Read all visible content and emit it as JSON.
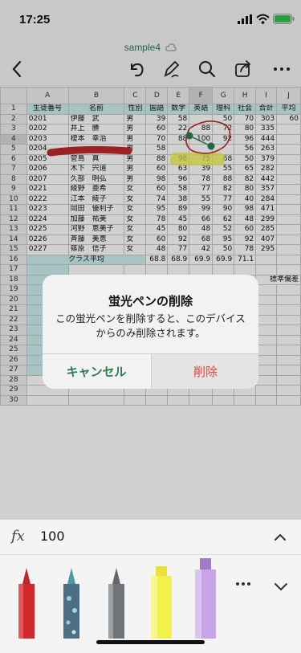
{
  "status": {
    "time": "17:25"
  },
  "document": {
    "title": "sample4"
  },
  "sheet": {
    "columns": [
      "",
      "A",
      "B",
      "C",
      "D",
      "E",
      "F",
      "G",
      "H",
      "I",
      "J"
    ],
    "header_row": [
      "生徒番号",
      "名前",
      "性別",
      "国語",
      "数学",
      "英語",
      "理科",
      "社会",
      "合計",
      "平均"
    ],
    "rows": [
      [
        "0201",
        "伊藤　武",
        "男",
        "39",
        "58",
        "",
        "50",
        "70",
        "303",
        "60"
      ],
      [
        "0202",
        "井上　勝",
        "男",
        "60",
        "22",
        "88",
        "72",
        "80",
        "335",
        ""
      ],
      [
        "0203",
        "榎本　幸治",
        "男",
        "70",
        "88",
        "100",
        "92",
        "96",
        "444",
        ""
      ],
      [
        "0204",
        "",
        "男",
        "58",
        "",
        "",
        "",
        "56",
        "263",
        ""
      ],
      [
        "0205",
        "菅島　真",
        "男",
        "88",
        "98",
        "75",
        "68",
        "50",
        "379",
        ""
      ],
      [
        "0206",
        "木下　宍道",
        "男",
        "60",
        "63",
        "39",
        "55",
        "65",
        "282",
        ""
      ],
      [
        "0207",
        "久部　明弘",
        "男",
        "98",
        "96",
        "78",
        "88",
        "82",
        "442",
        ""
      ],
      [
        "0221",
        "綾野　亜希",
        "女",
        "60",
        "58",
        "77",
        "82",
        "80",
        "357",
        ""
      ],
      [
        "0222",
        "江本　綾子",
        "女",
        "74",
        "38",
        "55",
        "77",
        "40",
        "284",
        ""
      ],
      [
        "0223",
        "岡田　優利子",
        "女",
        "95",
        "89",
        "99",
        "90",
        "98",
        "471",
        ""
      ],
      [
        "0224",
        "加藤　祐美",
        "女",
        "78",
        "45",
        "66",
        "62",
        "48",
        "299",
        ""
      ],
      [
        "0225",
        "河野　恵美子",
        "女",
        "45",
        "80",
        "48",
        "52",
        "60",
        "285",
        ""
      ],
      [
        "0226",
        "斉藤　美恵",
        "女",
        "60",
        "92",
        "68",
        "95",
        "92",
        "407",
        ""
      ],
      [
        "0227",
        "篠原　信子",
        "女",
        "48",
        "77",
        "42",
        "50",
        "78",
        "295",
        ""
      ]
    ],
    "avg_row": {
      "label": "クラス平均",
      "values": [
        "68.8",
        "68.9",
        "69.9",
        "69.9",
        "71.1"
      ]
    },
    "side_label": "標準偏差",
    "selected_value": "100"
  },
  "dialog": {
    "title": "蛍光ペンの削除",
    "message": "この蛍光ペンを削除すると、このデバイスからのみ削除されます。",
    "cancel": "キャンセル",
    "delete": "削除"
  },
  "formula": {
    "fx": "fx",
    "value": "100"
  },
  "colors": {
    "accent": "#2e7d4f",
    "destructive": "#e0453a",
    "header_fill": "#cdeeee",
    "red_pen": "#c0282b",
    "yellow_pen": "#f2f04a",
    "purple_pen": "#c8a3e8"
  },
  "pens": [
    "red-pen-icon",
    "blue-pen-icon",
    "gray-pen-icon",
    "yellow-highlighter-icon",
    "purple-highlighter-icon"
  ]
}
